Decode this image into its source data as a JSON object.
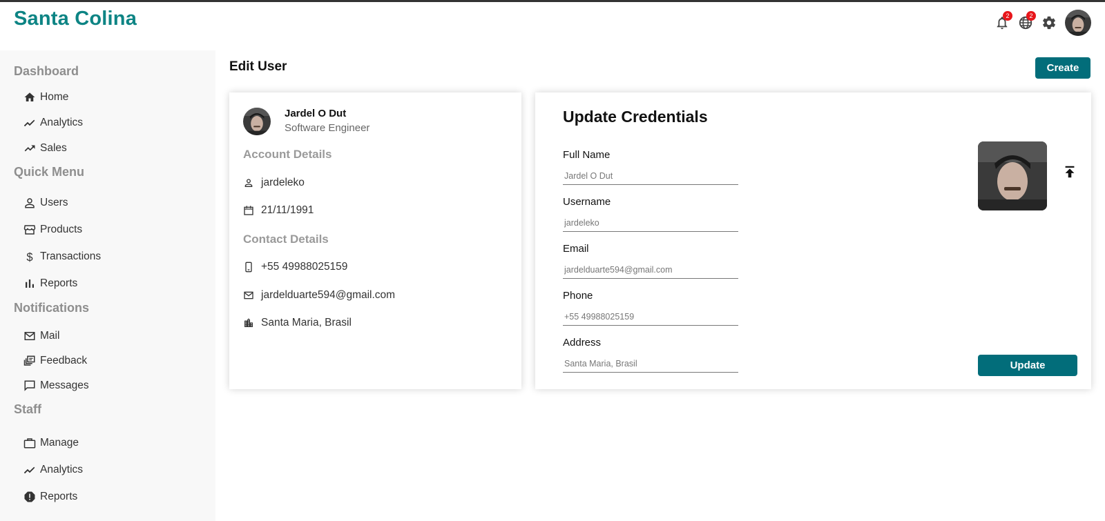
{
  "header": {
    "logo": "Santa Colina",
    "notifications_badge": "2",
    "language_badge": "2"
  },
  "sidebar": {
    "sections": [
      {
        "title": "Dashboard",
        "items": [
          {
            "label": "Home",
            "icon": "home-icon"
          },
          {
            "label": "Analytics",
            "icon": "line-chart-icon"
          },
          {
            "label": "Sales",
            "icon": "trending-up-icon"
          }
        ]
      },
      {
        "title": "Quick Menu",
        "items": [
          {
            "label": "Users",
            "icon": "person-icon"
          },
          {
            "label": "Products",
            "icon": "storefront-icon"
          },
          {
            "label": "Transactions",
            "icon": "dollar-icon"
          },
          {
            "label": "Reports",
            "icon": "bar-chart-icon"
          }
        ]
      },
      {
        "title": "Notifications",
        "items": [
          {
            "label": "Mail",
            "icon": "mail-icon"
          },
          {
            "label": "Feedback",
            "icon": "dynamic-feed-icon"
          },
          {
            "label": "Messages",
            "icon": "chat-bubble-icon"
          }
        ]
      },
      {
        "title": "Staff",
        "items": [
          {
            "label": "Manage",
            "icon": "briefcase-icon"
          },
          {
            "label": "Analytics",
            "icon": "line-chart-icon"
          },
          {
            "label": "Reports",
            "icon": "report-icon"
          }
        ]
      }
    ]
  },
  "main": {
    "title": "Edit User",
    "create_label": "Create"
  },
  "profile": {
    "name": "Jardel O Dut",
    "role": "Software Engineer",
    "account_title": "Account Details",
    "username": "jardeleko",
    "birthdate": "21/11/1991",
    "contact_title": "Contact Details",
    "phone": "+55 49988025159",
    "email": "jardelduarte594@gmail.com",
    "location": "Santa Maria, Brasil"
  },
  "update": {
    "title": "Update Credentials",
    "fields": {
      "full_name": {
        "label": "Full Name",
        "placeholder": "Jardel O Dut"
      },
      "username": {
        "label": "Username",
        "placeholder": "jardeleko"
      },
      "email": {
        "label": "Email",
        "placeholder": "jardelduarte594@gmail.com"
      },
      "phone": {
        "label": "Phone",
        "placeholder": "+55 49988025159"
      },
      "address": {
        "label": "Address",
        "placeholder": "Santa Maria, Brasil"
      }
    },
    "button_label": "Update"
  },
  "colors": {
    "brand": "#0d8484",
    "button": "#026d7a",
    "badge": "#e8161b",
    "sidebar_bg": "#f8f8f8"
  }
}
